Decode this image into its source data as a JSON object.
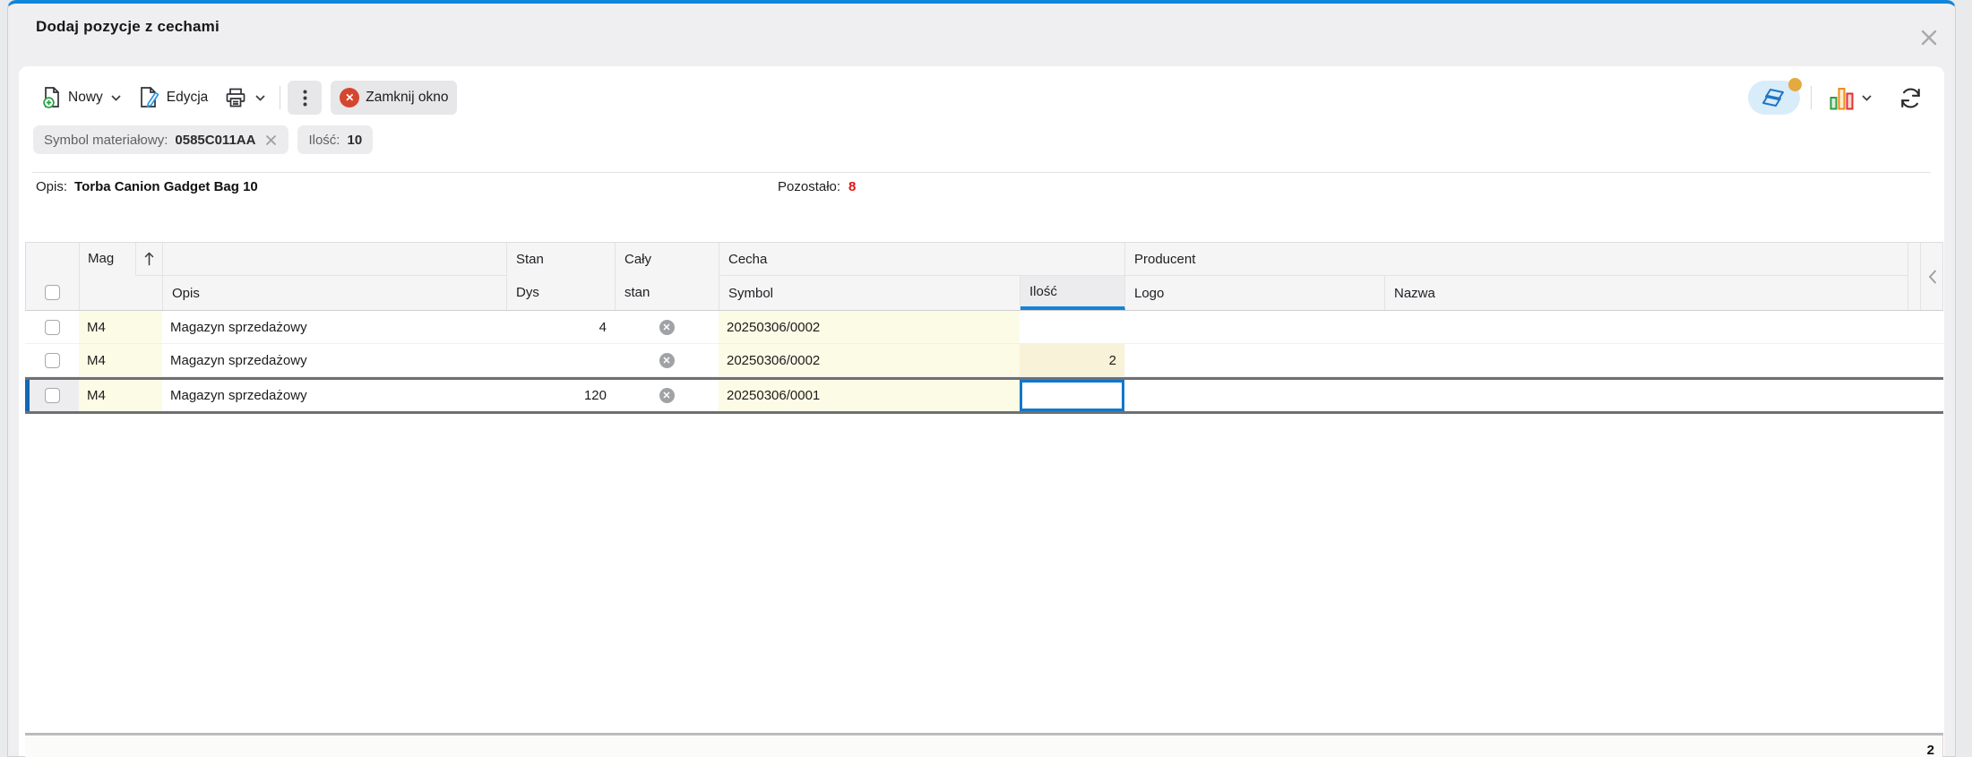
{
  "window": {
    "title": "Dodaj pozycje z cechami"
  },
  "toolbar": {
    "new_label": "Nowy",
    "edit_label": "Edycja",
    "close_window_label": "Zamknij okno"
  },
  "filters": [
    {
      "label": "Symbol materiałowy:",
      "value": "0585C011AA",
      "removable": true
    },
    {
      "label": "Ilość:",
      "value": "10",
      "removable": false
    }
  ],
  "info": {
    "opis_label": "Opis:",
    "opis_value": "Torba Canion Gadget Bag 10",
    "pozostalo_label": "Pozostało:",
    "pozostalo_value": "8"
  },
  "table": {
    "header": {
      "mag": "Mag",
      "opis": "Opis",
      "stan1": "Stan",
      "stan2": "Dys",
      "caly1": "Cały",
      "caly2": "stan",
      "cecha": "Cecha",
      "symbol": "Symbol",
      "ilosc": "Ilość",
      "producent": "Producent",
      "logo": "Logo",
      "nazwa": "Nazwa"
    },
    "rows": [
      {
        "mag": "M4",
        "opis": "Magazyn sprzedażowy",
        "stan_dys": "4",
        "symbol": "20250306/0002",
        "ilosc": "",
        "logo": "",
        "nazwa": ""
      },
      {
        "mag": "M4",
        "opis": "Magazyn sprzedażowy",
        "stan_dys": "",
        "symbol": "20250306/0002",
        "ilosc": "2",
        "logo": "",
        "nazwa": ""
      },
      {
        "mag": "M4",
        "opis": "Magazyn sprzedażowy",
        "stan_dys": "120",
        "symbol": "20250306/0001",
        "ilosc": "",
        "logo": "",
        "nazwa": "",
        "selected": true,
        "ilosc_focused": true
      }
    ],
    "summary": {
      "ilosc": "2"
    }
  },
  "icons": {
    "new": "document-plus-icon",
    "edit": "document-pencil-icon",
    "print": "printer-icon",
    "more": "kebab-menu-icon",
    "close_window": "red-circle-x-icon",
    "duplicate": "duplicate-window-icon",
    "chart": "bar-chart-icon",
    "refresh": "refresh-icon",
    "dialog_close": "close-icon",
    "chip_remove": "remove-filter-icon",
    "sort": "sort-ascending-icon",
    "clear_value": "clear-value-circle-x-icon",
    "collapse": "collapse-panel-chevron-icon"
  },
  "colors": {
    "accent_blue": "#1583d6",
    "selected_row_border": "#6f6f71",
    "selected_row_bar": "#1566b2",
    "cell_yellow": "#fbfbe6",
    "cell_yellow_qty": "#f7f2d8",
    "danger_red": "#e51317",
    "close_btn_red": "#d5462f",
    "badge_orange": "#e3aa3f",
    "header_bg": "#f5f5f6",
    "window_top_border": "#1085da"
  }
}
